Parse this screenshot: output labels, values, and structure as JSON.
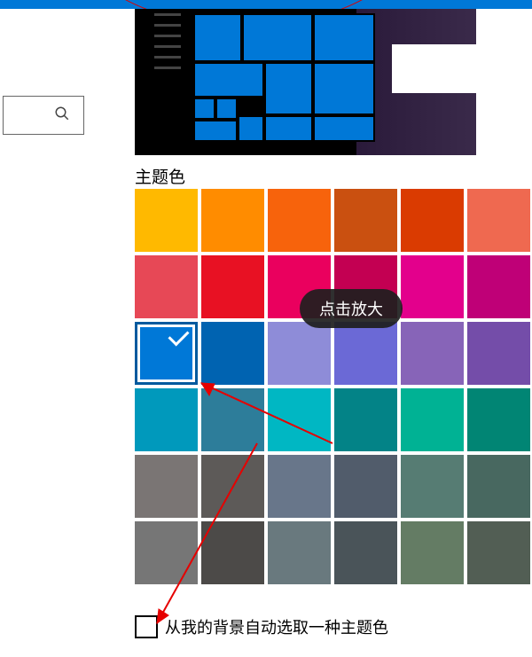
{
  "section_title": "主题色",
  "tooltip": "点击放大",
  "auto_pick_label": "从我的背景自动选取一种主题色",
  "selected_color": "#0078d7",
  "colors": [
    {
      "hex": "#ffb900"
    },
    {
      "hex": "#ff8c00"
    },
    {
      "hex": "#f7630c"
    },
    {
      "hex": "#ca5010"
    },
    {
      "hex": "#da3b01"
    },
    {
      "hex": "#ef6950"
    },
    {
      "hex": "#e74856"
    },
    {
      "hex": "#e81123"
    },
    {
      "hex": "#ea005e"
    },
    {
      "hex": "#c30052"
    },
    {
      "hex": "#e3008c"
    },
    {
      "hex": "#bf0077"
    },
    {
      "hex": "#0078d7"
    },
    {
      "hex": "#0063b1"
    },
    {
      "hex": "#8e8cd8"
    },
    {
      "hex": "#6b69d6"
    },
    {
      "hex": "#8764b8"
    },
    {
      "hex": "#744da9"
    },
    {
      "hex": "#0099bc"
    },
    {
      "hex": "#2d7d9a"
    },
    {
      "hex": "#00b7c3"
    },
    {
      "hex": "#038387"
    },
    {
      "hex": "#00b294"
    },
    {
      "hex": "#018574"
    },
    {
      "hex": "#7a7574"
    },
    {
      "hex": "#5d5a58"
    },
    {
      "hex": "#68768a"
    },
    {
      "hex": "#515c6b"
    },
    {
      "hex": "#567c73"
    },
    {
      "hex": "#486860"
    },
    {
      "hex": "#767676"
    },
    {
      "hex": "#4c4a48"
    },
    {
      "hex": "#69797e"
    },
    {
      "hex": "#4a5459"
    },
    {
      "hex": "#647c64"
    },
    {
      "hex": "#525e54"
    }
  ]
}
